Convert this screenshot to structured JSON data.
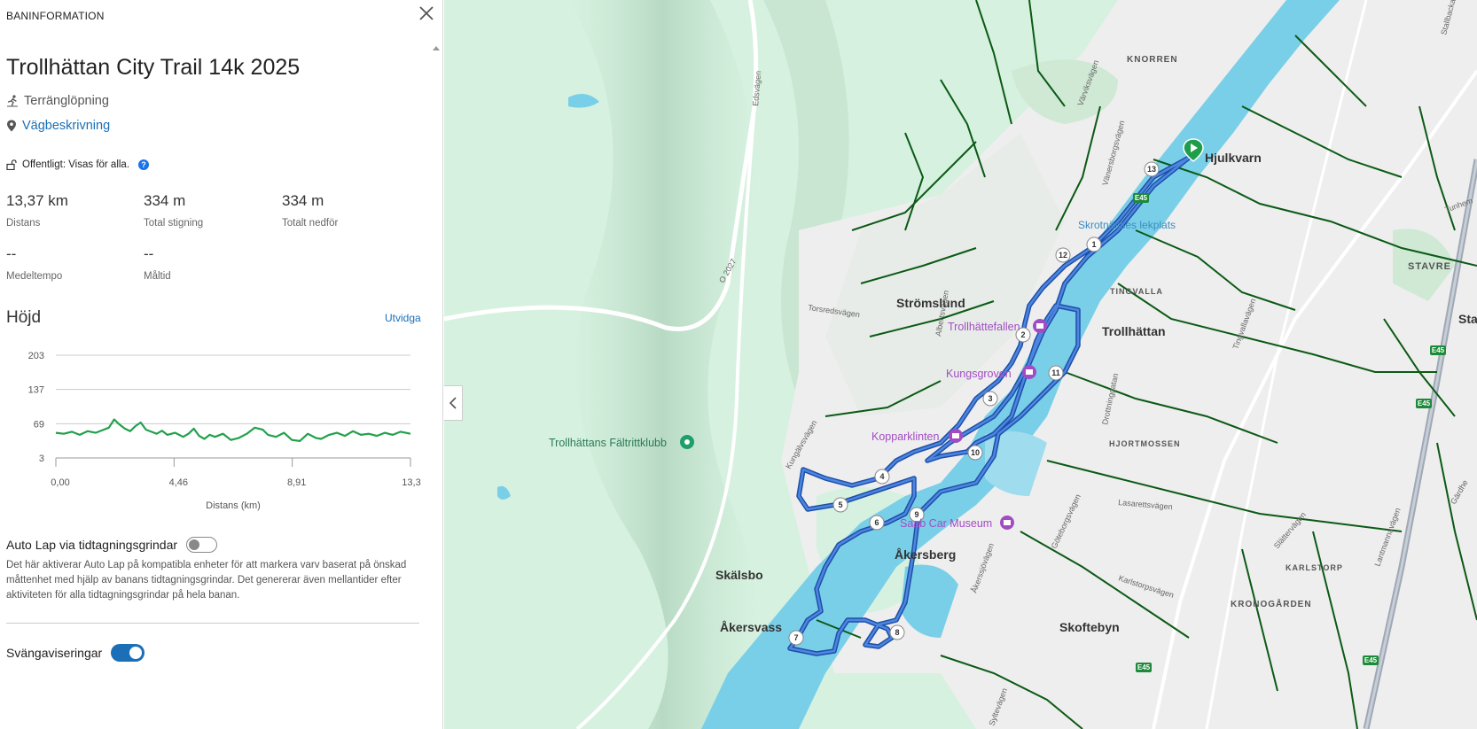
{
  "panel": {
    "header": "BANINFORMATION",
    "title": "Trollhättan City Trail 14k 2025",
    "activity_type": "Terränglöpning",
    "directions_link": "Vägbeskrivning",
    "visibility": "Offentligt: Visas för alla.",
    "stats": [
      {
        "value": "13,37 km",
        "label": "Distans"
      },
      {
        "value": "334 m",
        "label": "Total stigning"
      },
      {
        "value": "334 m",
        "label": "Totalt nedför"
      },
      {
        "value": "--",
        "label": "Medeltempo"
      },
      {
        "value": "--",
        "label": "Måltid"
      }
    ],
    "elevation_title": "Höjd",
    "expand_label": "Utvidga",
    "auto_lap_label": "Auto Lap via tidtagningsgrindar",
    "auto_lap_enabled": false,
    "auto_lap_description": "Det här aktiverar Auto Lap på kompatibla enheter för att markera varv baserat på önskad måttenhet med hjälp av banans tidtagningsgrindar. Det genererar även mellantider efter aktiviteten för alla tidtagningsgrindar på hela banan.",
    "turn_guidance_label": "Svängaviseringar",
    "turn_guidance_enabled": true
  },
  "chart_data": {
    "type": "line",
    "title": "Höjd",
    "xlabel": "Distans (km)",
    "ylabel": "",
    "xlim": [
      0,
      13.37
    ],
    "ylim": [
      3,
      203
    ],
    "y_ticks": [
      "203",
      "137",
      "69",
      "3"
    ],
    "x_ticks": [
      "0,00",
      "4,46",
      "8,91",
      "13,3"
    ],
    "grid": true,
    "color": "#22a04a",
    "series": [
      {
        "x": [
          0,
          0.3,
          0.6,
          0.9,
          1.2,
          1.5,
          1.8,
          2.0,
          2.2,
          2.4,
          2.6,
          2.8,
          3.0,
          3.2,
          3.4,
          3.6,
          3.8,
          4.0,
          4.2,
          4.5,
          4.8,
          5.0,
          5.2,
          5.4,
          5.6,
          5.8,
          6.0,
          6.3,
          6.6,
          6.9,
          7.2,
          7.5,
          7.8,
          8.0,
          8.3,
          8.6,
          8.9,
          9.2,
          9.5,
          9.8,
          10.0,
          10.3,
          10.6,
          10.9,
          11.2,
          11.5,
          11.8,
          12.1,
          12.4,
          12.7,
          13.0,
          13.37
        ],
        "y": [
          52,
          50,
          54,
          48,
          55,
          52,
          58,
          62,
          78,
          68,
          60,
          55,
          65,
          72,
          58,
          54,
          50,
          56,
          48,
          52,
          44,
          50,
          60,
          46,
          40,
          48,
          44,
          50,
          38,
          42,
          50,
          62,
          58,
          48,
          44,
          52,
          38,
          36,
          50,
          42,
          40,
          48,
          52,
          46,
          55,
          48,
          50,
          46,
          52,
          48,
          54,
          50
        ]
      }
    ]
  },
  "map": {
    "colors": {
      "land": "#d9f2e2",
      "urban": "#eeeeee",
      "water": "#79cfe8",
      "route": "#2e64c6",
      "paths": "#0b5a15"
    },
    "place_labels": [
      "KNORREN",
      "Hjulkvarn",
      "STAVRE",
      "Sta",
      "TINGVALLA",
      "Strömslund",
      "Trollhättan",
      "HJORTMOSSEN",
      "KARLSTORP",
      "Åkersberg",
      "Skälsbo",
      "Åkersvass",
      "Skoftebyn",
      "KRONOGÅRDEN"
    ],
    "pois": [
      "Trollhättefallen",
      "Kungsgroven",
      "Kopparklinten",
      "Saab Car Museum",
      "Trollhättans Fältrittklubb",
      "Skrotnässes lekplats"
    ],
    "road_labels": [
      "Edsvägen",
      "O 2027",
      "Torsredsvägen",
      "Albertsvägen",
      "Värviksvägen",
      "Vänersborgsvägen",
      "Drottninggatan",
      "Tingvallavägen",
      "Kungälvsvägen",
      "Åkerssjövägen",
      "Göteborgsvägen",
      "Karlstorpsvägen",
      "Slättervägen",
      "Lantmannavägen",
      "Lasarettsvägen",
      "Stallbacka",
      "Tunhem",
      "Gärdhe",
      "Syltevägen"
    ],
    "route_markers": [
      "1",
      "2",
      "3",
      "4",
      "5",
      "6",
      "7",
      "8",
      "9",
      "10",
      "11",
      "12",
      "13"
    ],
    "highway_shields": [
      "E45",
      "E45",
      "E45",
      "E45",
      "E45"
    ]
  }
}
